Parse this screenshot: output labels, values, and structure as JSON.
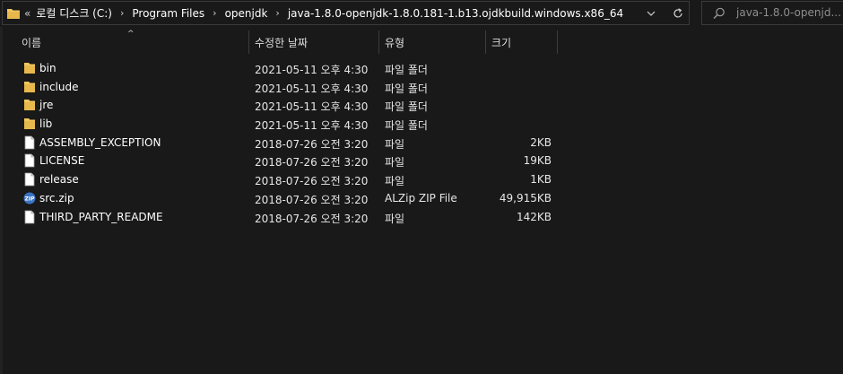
{
  "address": {
    "overflow": "«",
    "crumbs": [
      "로컬 디스크 (C:)",
      "Program Files",
      "openjdk",
      "java-1.8.0-openjdk-1.8.0.181-1.b13.ojdkbuild.windows.x86_64"
    ],
    "separator": "›"
  },
  "search": {
    "placeholder": "java-1.8.0-openjd..."
  },
  "columns": {
    "name": "이름",
    "date": "수정한 날짜",
    "type": "유형",
    "size": "크기"
  },
  "files": [
    {
      "name": "bin",
      "date": "2021-05-11 오후 4:30",
      "type": "파일 폴더",
      "size": "",
      "icon": "folder-icon"
    },
    {
      "name": "include",
      "date": "2021-05-11 오후 4:30",
      "type": "파일 폴더",
      "size": "",
      "icon": "folder-icon"
    },
    {
      "name": "jre",
      "date": "2021-05-11 오후 4:30",
      "type": "파일 폴더",
      "size": "",
      "icon": "folder-icon"
    },
    {
      "name": "lib",
      "date": "2021-05-11 오후 4:30",
      "type": "파일 폴더",
      "size": "",
      "icon": "folder-icon"
    },
    {
      "name": "ASSEMBLY_EXCEPTION",
      "date": "2018-07-26 오전 3:20",
      "type": "파일",
      "size": "2KB",
      "icon": "file-icon"
    },
    {
      "name": "LICENSE",
      "date": "2018-07-26 오전 3:20",
      "type": "파일",
      "size": "19KB",
      "icon": "file-icon"
    },
    {
      "name": "release",
      "date": "2018-07-26 오전 3:20",
      "type": "파일",
      "size": "1KB",
      "icon": "file-icon"
    },
    {
      "name": "src.zip",
      "date": "2018-07-26 오전 3:20",
      "type": "ALZip ZIP File",
      "size": "49,915KB",
      "icon": "zip-icon"
    },
    {
      "name": "THIRD_PARTY_README",
      "date": "2018-07-26 오전 3:20",
      "type": "파일",
      "size": "142KB",
      "icon": "file-icon"
    }
  ],
  "colors": {
    "background": "#191919",
    "folder": "#f0c75e",
    "border": "#3a3a3a"
  }
}
